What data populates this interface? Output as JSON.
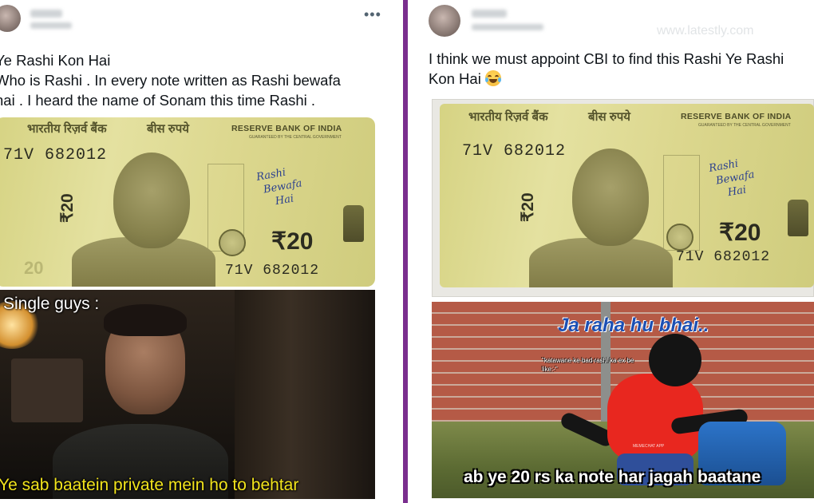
{
  "left_tweet": {
    "text_lines": [
      "Ye Rashi Kon Hai",
      "Who is Rashi . In every note written as Rashi bewafa",
      "hai . I heard the name of Sonam this time Rashi ."
    ],
    "more_icon": "more-horizontal-icon",
    "note": {
      "hindi_bank": "भारतीय रिज़र्व बैंक",
      "hindi_value": "बीस रुपये",
      "rbi": "RESERVE BANK OF INDIA",
      "guarantee": "GUARANTEED BY THE CENTRAL GOVERNMENT",
      "serial_top": "71V 682012",
      "serial_bottom": "71V 682012",
      "vertical_value": "₹20",
      "value": "₹20",
      "faint_value": "20",
      "handwriting": [
        "Rashi",
        "Bewafa",
        "Hai"
      ]
    },
    "meme": {
      "caption_top": "Single guys :",
      "caption_bottom": "Ye sab baatein private mein ho to behtar"
    }
  },
  "right_tweet": {
    "text_lines": [
      "I think we must appoint CBI to find this Rashi Ye Rashi",
      "Kon Hai"
    ],
    "emoji": "face-with-tears-of-joy",
    "site_watermark": "www.latestly.com",
    "note": {
      "hindi_bank": "भारतीय रिज़र्व बैंक",
      "hindi_value": "बीस रुपये",
      "rbi": "RESERVE BANK OF INDIA",
      "guarantee": "GUARANTEED BY THE CENTRAL GOVERNMENT",
      "serial_top": "71V 682012",
      "serial_bottom": "71V 682012",
      "vertical_value": "₹20",
      "value": "₹20",
      "handwriting": [
        "Rashi",
        "Bewafa",
        "Hai"
      ]
    },
    "meme": {
      "caption_top": "Ja raha hu bhai..",
      "caption_small": "\"katawane ke bad rashi ka ex be like:-\"",
      "app_watermark": "MEMECHAT APP",
      "caption_bottom": "ab ye 20 rs ka note har jagah baatane"
    }
  },
  "colors": {
    "divider": "#7a2e8e",
    "caption_yellow": "#f2e41c",
    "caption_blue": "#1b4fb3",
    "handwriting_ink": "#2a3f8f"
  }
}
